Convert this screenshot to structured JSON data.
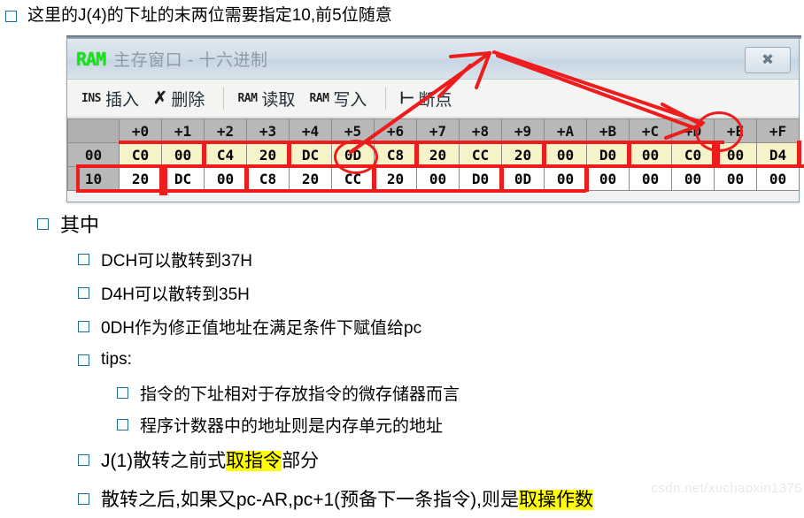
{
  "headline": {
    "text": "这里的J(4)的下址的末两位需要指定10,前5位随意"
  },
  "ram_window": {
    "logo": "RAM",
    "title": "主存窗口 - 十六进制",
    "close_label": "✖",
    "toolbar": [
      {
        "icon": "INS",
        "icon_kind": "ins-text",
        "label": "插入"
      },
      {
        "icon": "✗",
        "icon_kind": "delete-cross",
        "label": "删除"
      },
      {
        "icon": "RAM",
        "icon_kind": "ram-read",
        "label": "读取"
      },
      {
        "icon": "RAM",
        "icon_kind": "ram-write",
        "label": "写入"
      },
      {
        "icon": "⊢",
        "icon_kind": "breakpoint",
        "label": "断点"
      }
    ],
    "separators_after": [
      1,
      3
    ],
    "hex_table": {
      "corner_label": "",
      "column_headers": [
        "+0",
        "+1",
        "+2",
        "+3",
        "+4",
        "+5",
        "+6",
        "+7",
        "+8",
        "+9",
        "+A",
        "+B",
        "+C",
        "+D",
        "+E",
        "+F"
      ],
      "rows": [
        {
          "address": "00",
          "cells": [
            "C0",
            "00",
            "C4",
            "20",
            "DC",
            "0D",
            "C8",
            "20",
            "CC",
            "20",
            "00",
            "D0",
            "00",
            "C0",
            "00",
            "D4"
          ]
        },
        {
          "address": "10",
          "cells": [
            "20",
            "DC",
            "00",
            "C8",
            "20",
            "CC",
            "20",
            "00",
            "D0",
            "0D",
            "00",
            "00",
            "00",
            "00",
            "00",
            "00"
          ]
        }
      ]
    },
    "annotations": {
      "circled_cells": [
        "row0-col5-0D",
        "header-col13-+D"
      ],
      "accent_color": "#ee1c1c"
    }
  },
  "bullets": [
    {
      "level": 1,
      "text": "其中"
    },
    {
      "level": 2,
      "text": "DCH可以散转到37H"
    },
    {
      "level": 2,
      "text": "D4H可以散转到35H"
    },
    {
      "level": 2,
      "text": "0DH作为修正值地址在满足条件下赋值给pc"
    },
    {
      "level": 2,
      "text": "tips:"
    },
    {
      "level": 3,
      "text": "指令的下址相对于存放指令的微存储器而言"
    },
    {
      "level": 3,
      "text": "程序计数器中的地址则是内存单元的地址"
    },
    {
      "level": 2,
      "parts": [
        {
          "text": "J(1)散转之前式",
          "highlight": false
        },
        {
          "text": "取指令",
          "highlight": true
        },
        {
          "text": "部分",
          "highlight": false
        }
      ]
    },
    {
      "level": 2,
      "parts": [
        {
          "text": "散转之后,如果又pc-AR,pc+1(预备下一条指令),则是",
          "highlight": false
        },
        {
          "text": "取操作数",
          "highlight": true
        }
      ]
    }
  ],
  "watermark": {
    "text": "csdn.net/xuchaoxin1375"
  },
  "colors": {
    "annotation_red": "#ee1c1c",
    "highlight_yellow": "#ffff00",
    "ram_green": "#19e319",
    "row0_bg": "#f7f3c8",
    "checkbox_border": "#1f6f93"
  }
}
